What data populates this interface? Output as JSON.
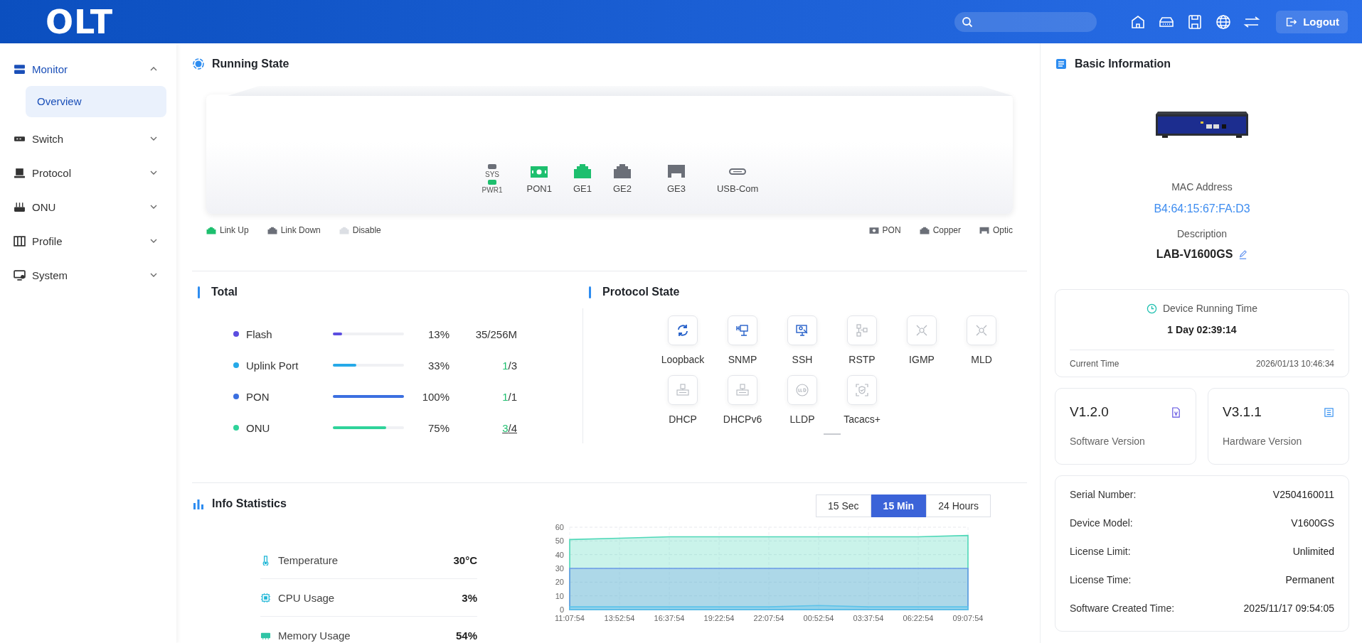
{
  "header": {
    "logo": "OLT",
    "logout": "Logout"
  },
  "sidebar": {
    "items": [
      {
        "label": "Monitor",
        "expanded": true,
        "children": [
          {
            "label": "Overview",
            "selected": true
          }
        ]
      },
      {
        "label": "Switch",
        "expanded": false
      },
      {
        "label": "Protocol",
        "expanded": false
      },
      {
        "label": "ONU",
        "expanded": false
      },
      {
        "label": "Profile",
        "expanded": false
      },
      {
        "label": "System",
        "expanded": false
      }
    ]
  },
  "running_state": {
    "title": "Running State",
    "leds": [
      {
        "label": "SYS",
        "on": false
      },
      {
        "label": "PWR1",
        "on": true
      }
    ],
    "ports": [
      {
        "label": "PON1",
        "kind": "pon",
        "link_up": true
      },
      {
        "label": "GE1",
        "kind": "copper",
        "link_up": true
      },
      {
        "label": "GE2",
        "kind": "copper",
        "link_up": false
      },
      {
        "label": "GE3",
        "kind": "optic",
        "link_up": false
      },
      {
        "label": "USB-Com",
        "kind": "usb",
        "link_up": false
      }
    ],
    "status_legend": [
      {
        "label": "Link Up",
        "color": "#1dbf6e"
      },
      {
        "label": "Link Down",
        "color": "#6b6f78"
      },
      {
        "label": "Disable",
        "color": "#dcdfe4"
      }
    ],
    "kind_legend": [
      {
        "label": "PON",
        "kind": "pon"
      },
      {
        "label": "Copper",
        "kind": "copper"
      },
      {
        "label": "Optic",
        "kind": "optic"
      }
    ]
  },
  "total": {
    "title": "Total",
    "rows": [
      {
        "label": "Flash",
        "color": "#5b4de0",
        "level": 0.13,
        "percent": "13%",
        "kind": "plain",
        "value": "35/256M"
      },
      {
        "label": "Uplink Port",
        "color": "#26a9e8",
        "level": 0.33,
        "percent": "33%",
        "kind": "fraction",
        "used": "1",
        "of": "/3",
        "link": false
      },
      {
        "label": "PON",
        "color": "#3b6fe0",
        "level": 1,
        "percent": "100%",
        "kind": "fraction",
        "used": "1",
        "of": "/1",
        "link": false
      },
      {
        "label": "ONU",
        "color": "#2fd39a",
        "level": 0.75,
        "percent": "75%",
        "kind": "fraction",
        "used": "3",
        "of": "/4",
        "link": true
      }
    ]
  },
  "protocol_state": {
    "title": "Protocol State",
    "items": [
      {
        "label": "Loopback",
        "enabled": true
      },
      {
        "label": "SNMP",
        "enabled": true
      },
      {
        "label": "SSH",
        "enabled": true
      },
      {
        "label": "RSTP",
        "enabled": false
      },
      {
        "label": "IGMP",
        "enabled": false
      },
      {
        "label": "MLD",
        "enabled": false
      },
      {
        "label": "DHCP",
        "enabled": false
      },
      {
        "label": "DHCPv6",
        "enabled": false
      },
      {
        "label": "LLDP",
        "enabled": false
      },
      {
        "label": "Tacacs+",
        "enabled": false
      }
    ]
  },
  "info_statistics": {
    "title": "Info Statistics",
    "ranges": [
      {
        "label": "15 Sec",
        "selected": false
      },
      {
        "label": "15 Min",
        "selected": true
      },
      {
        "label": "24 Hours",
        "selected": false
      }
    ],
    "stats": [
      {
        "label": "Temperature",
        "value": "30°C"
      },
      {
        "label": "CPU Usage",
        "value": "3%"
      },
      {
        "label": "Memory Usage",
        "value": "54%"
      }
    ],
    "chart_data": {
      "type": "area",
      "grid": true,
      "categories": [
        "11:07:54",
        "13:52:54",
        "16:37:54",
        "19:22:54",
        "22:07:54",
        "00:52:54",
        "03:37:54",
        "06:22:54",
        "09:07:54"
      ],
      "ylim": [
        0,
        60
      ],
      "yticks": [
        0,
        10,
        20,
        30,
        40,
        50,
        60
      ],
      "series": [
        {
          "color": "#4fd8b8",
          "values": [
            51,
            52,
            53,
            53,
            53,
            53,
            53,
            53,
            54
          ]
        },
        {
          "color": "#6a9be6",
          "values": [
            30,
            30,
            30,
            30,
            30,
            30,
            30,
            30,
            30
          ]
        },
        {
          "color": "#5cc3ea",
          "values": [
            2,
            2,
            2,
            2,
            2,
            3,
            2,
            2,
            2
          ]
        }
      ]
    }
  },
  "basic_information": {
    "title": "Basic Information",
    "mac_label": "MAC Address",
    "mac": "B4:64:15:67:FA:D3",
    "description_label": "Description",
    "description": "LAB-V1600GS",
    "running_time": {
      "label": "Device Running Time",
      "value": "1 Day 02:39:14",
      "current_label": "Current Time",
      "current": "2026/01/13 10:46:34"
    },
    "versions": [
      {
        "value": "V1.2.0",
        "label": "Software Version"
      },
      {
        "value": "V3.1.1",
        "label": "Hardware Version"
      }
    ],
    "details": [
      {
        "label": "Serial Number:",
        "value": "V2504160011"
      },
      {
        "label": "Device Model:",
        "value": "V1600GS"
      },
      {
        "label": "License Limit:",
        "value": "Unlimited"
      },
      {
        "label": "License Time:",
        "value": "Permanent"
      },
      {
        "label": "Software Created Time:",
        "value": "2025/11/17 09:54:05"
      }
    ]
  }
}
